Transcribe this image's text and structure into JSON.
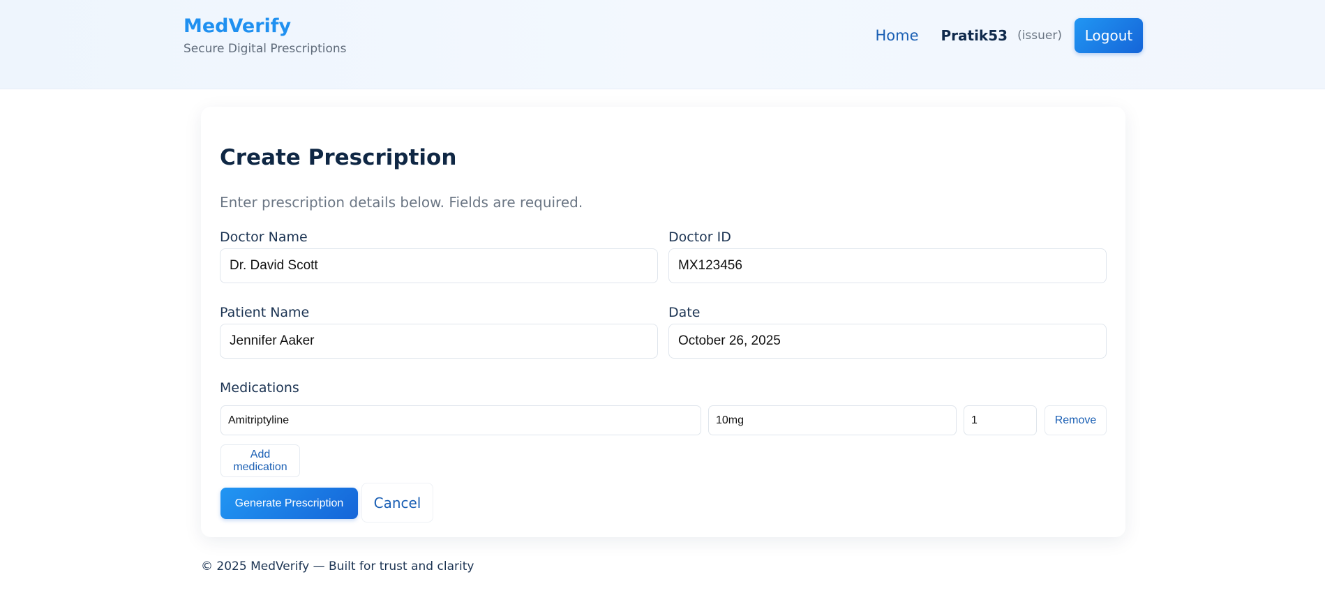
{
  "header": {
    "brand_name": "MedVerify",
    "tagline": "Secure Digital Prescriptions",
    "nav": {
      "home_label": "Home",
      "username": "Pratik53",
      "role": "(issuer)",
      "logout_label": "Logout"
    }
  },
  "form": {
    "title": "Create Prescription",
    "subtitle": "Enter prescription details below. Fields are required.",
    "doctor_name": {
      "label": "Doctor Name",
      "value": "Dr. David Scott"
    },
    "doctor_id": {
      "label": "Doctor ID",
      "value": "MX123456"
    },
    "patient_name": {
      "label": "Patient Name",
      "value": "Jennifer Aaker"
    },
    "date": {
      "label": "Date",
      "value": "October 26, 2025"
    },
    "medications": {
      "label": "Medications",
      "items": [
        {
          "name": "Amitriptyline",
          "dose": "10mg",
          "quantity": "1",
          "remove_label": "Remove"
        }
      ],
      "add_label": "Add medication"
    },
    "generate_label": "Generate Prescription",
    "cancel_label": "Cancel"
  },
  "footer": {
    "text": "© 2025 MedVerify — Built for trust and clarity"
  },
  "colors": {
    "brand": "#1f90f0",
    "primary_gradient_start": "#2196f3",
    "primary_gradient_end": "#1565d8",
    "link": "#1a5fb4",
    "heading": "#0f2744"
  }
}
